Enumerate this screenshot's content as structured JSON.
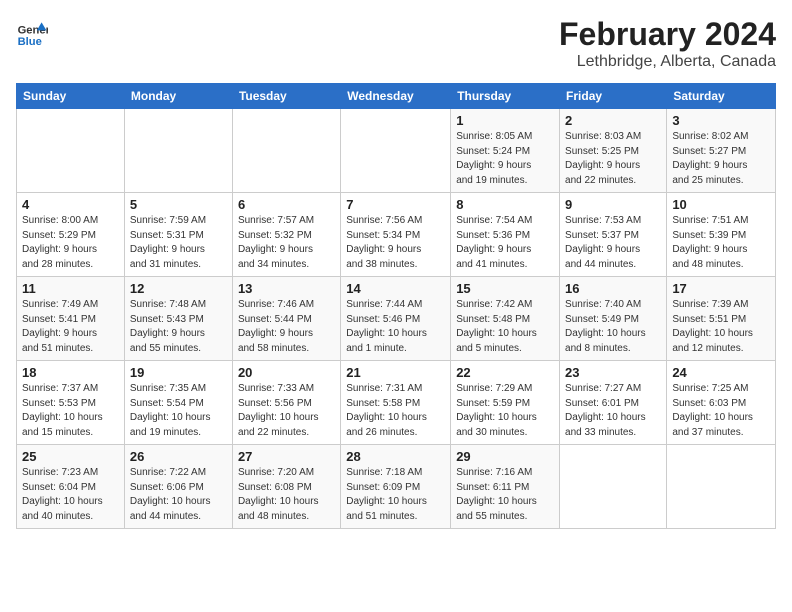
{
  "header": {
    "logo_line1": "General",
    "logo_line2": "Blue",
    "month_year": "February 2024",
    "location": "Lethbridge, Alberta, Canada"
  },
  "days_of_week": [
    "Sunday",
    "Monday",
    "Tuesday",
    "Wednesday",
    "Thursday",
    "Friday",
    "Saturday"
  ],
  "weeks": [
    [
      {
        "day": "",
        "info": ""
      },
      {
        "day": "",
        "info": ""
      },
      {
        "day": "",
        "info": ""
      },
      {
        "day": "",
        "info": ""
      },
      {
        "day": "1",
        "info": "Sunrise: 8:05 AM\nSunset: 5:24 PM\nDaylight: 9 hours\nand 19 minutes."
      },
      {
        "day": "2",
        "info": "Sunrise: 8:03 AM\nSunset: 5:25 PM\nDaylight: 9 hours\nand 22 minutes."
      },
      {
        "day": "3",
        "info": "Sunrise: 8:02 AM\nSunset: 5:27 PM\nDaylight: 9 hours\nand 25 minutes."
      }
    ],
    [
      {
        "day": "4",
        "info": "Sunrise: 8:00 AM\nSunset: 5:29 PM\nDaylight: 9 hours\nand 28 minutes."
      },
      {
        "day": "5",
        "info": "Sunrise: 7:59 AM\nSunset: 5:31 PM\nDaylight: 9 hours\nand 31 minutes."
      },
      {
        "day": "6",
        "info": "Sunrise: 7:57 AM\nSunset: 5:32 PM\nDaylight: 9 hours\nand 34 minutes."
      },
      {
        "day": "7",
        "info": "Sunrise: 7:56 AM\nSunset: 5:34 PM\nDaylight: 9 hours\nand 38 minutes."
      },
      {
        "day": "8",
        "info": "Sunrise: 7:54 AM\nSunset: 5:36 PM\nDaylight: 9 hours\nand 41 minutes."
      },
      {
        "day": "9",
        "info": "Sunrise: 7:53 AM\nSunset: 5:37 PM\nDaylight: 9 hours\nand 44 minutes."
      },
      {
        "day": "10",
        "info": "Sunrise: 7:51 AM\nSunset: 5:39 PM\nDaylight: 9 hours\nand 48 minutes."
      }
    ],
    [
      {
        "day": "11",
        "info": "Sunrise: 7:49 AM\nSunset: 5:41 PM\nDaylight: 9 hours\nand 51 minutes."
      },
      {
        "day": "12",
        "info": "Sunrise: 7:48 AM\nSunset: 5:43 PM\nDaylight: 9 hours\nand 55 minutes."
      },
      {
        "day": "13",
        "info": "Sunrise: 7:46 AM\nSunset: 5:44 PM\nDaylight: 9 hours\nand 58 minutes."
      },
      {
        "day": "14",
        "info": "Sunrise: 7:44 AM\nSunset: 5:46 PM\nDaylight: 10 hours\nand 1 minute."
      },
      {
        "day": "15",
        "info": "Sunrise: 7:42 AM\nSunset: 5:48 PM\nDaylight: 10 hours\nand 5 minutes."
      },
      {
        "day": "16",
        "info": "Sunrise: 7:40 AM\nSunset: 5:49 PM\nDaylight: 10 hours\nand 8 minutes."
      },
      {
        "day": "17",
        "info": "Sunrise: 7:39 AM\nSunset: 5:51 PM\nDaylight: 10 hours\nand 12 minutes."
      }
    ],
    [
      {
        "day": "18",
        "info": "Sunrise: 7:37 AM\nSunset: 5:53 PM\nDaylight: 10 hours\nand 15 minutes."
      },
      {
        "day": "19",
        "info": "Sunrise: 7:35 AM\nSunset: 5:54 PM\nDaylight: 10 hours\nand 19 minutes."
      },
      {
        "day": "20",
        "info": "Sunrise: 7:33 AM\nSunset: 5:56 PM\nDaylight: 10 hours\nand 22 minutes."
      },
      {
        "day": "21",
        "info": "Sunrise: 7:31 AM\nSunset: 5:58 PM\nDaylight: 10 hours\nand 26 minutes."
      },
      {
        "day": "22",
        "info": "Sunrise: 7:29 AM\nSunset: 5:59 PM\nDaylight: 10 hours\nand 30 minutes."
      },
      {
        "day": "23",
        "info": "Sunrise: 7:27 AM\nSunset: 6:01 PM\nDaylight: 10 hours\nand 33 minutes."
      },
      {
        "day": "24",
        "info": "Sunrise: 7:25 AM\nSunset: 6:03 PM\nDaylight: 10 hours\nand 37 minutes."
      }
    ],
    [
      {
        "day": "25",
        "info": "Sunrise: 7:23 AM\nSunset: 6:04 PM\nDaylight: 10 hours\nand 40 minutes."
      },
      {
        "day": "26",
        "info": "Sunrise: 7:22 AM\nSunset: 6:06 PM\nDaylight: 10 hours\nand 44 minutes."
      },
      {
        "day": "27",
        "info": "Sunrise: 7:20 AM\nSunset: 6:08 PM\nDaylight: 10 hours\nand 48 minutes."
      },
      {
        "day": "28",
        "info": "Sunrise: 7:18 AM\nSunset: 6:09 PM\nDaylight: 10 hours\nand 51 minutes."
      },
      {
        "day": "29",
        "info": "Sunrise: 7:16 AM\nSunset: 6:11 PM\nDaylight: 10 hours\nand 55 minutes."
      },
      {
        "day": "",
        "info": ""
      },
      {
        "day": "",
        "info": ""
      }
    ]
  ]
}
